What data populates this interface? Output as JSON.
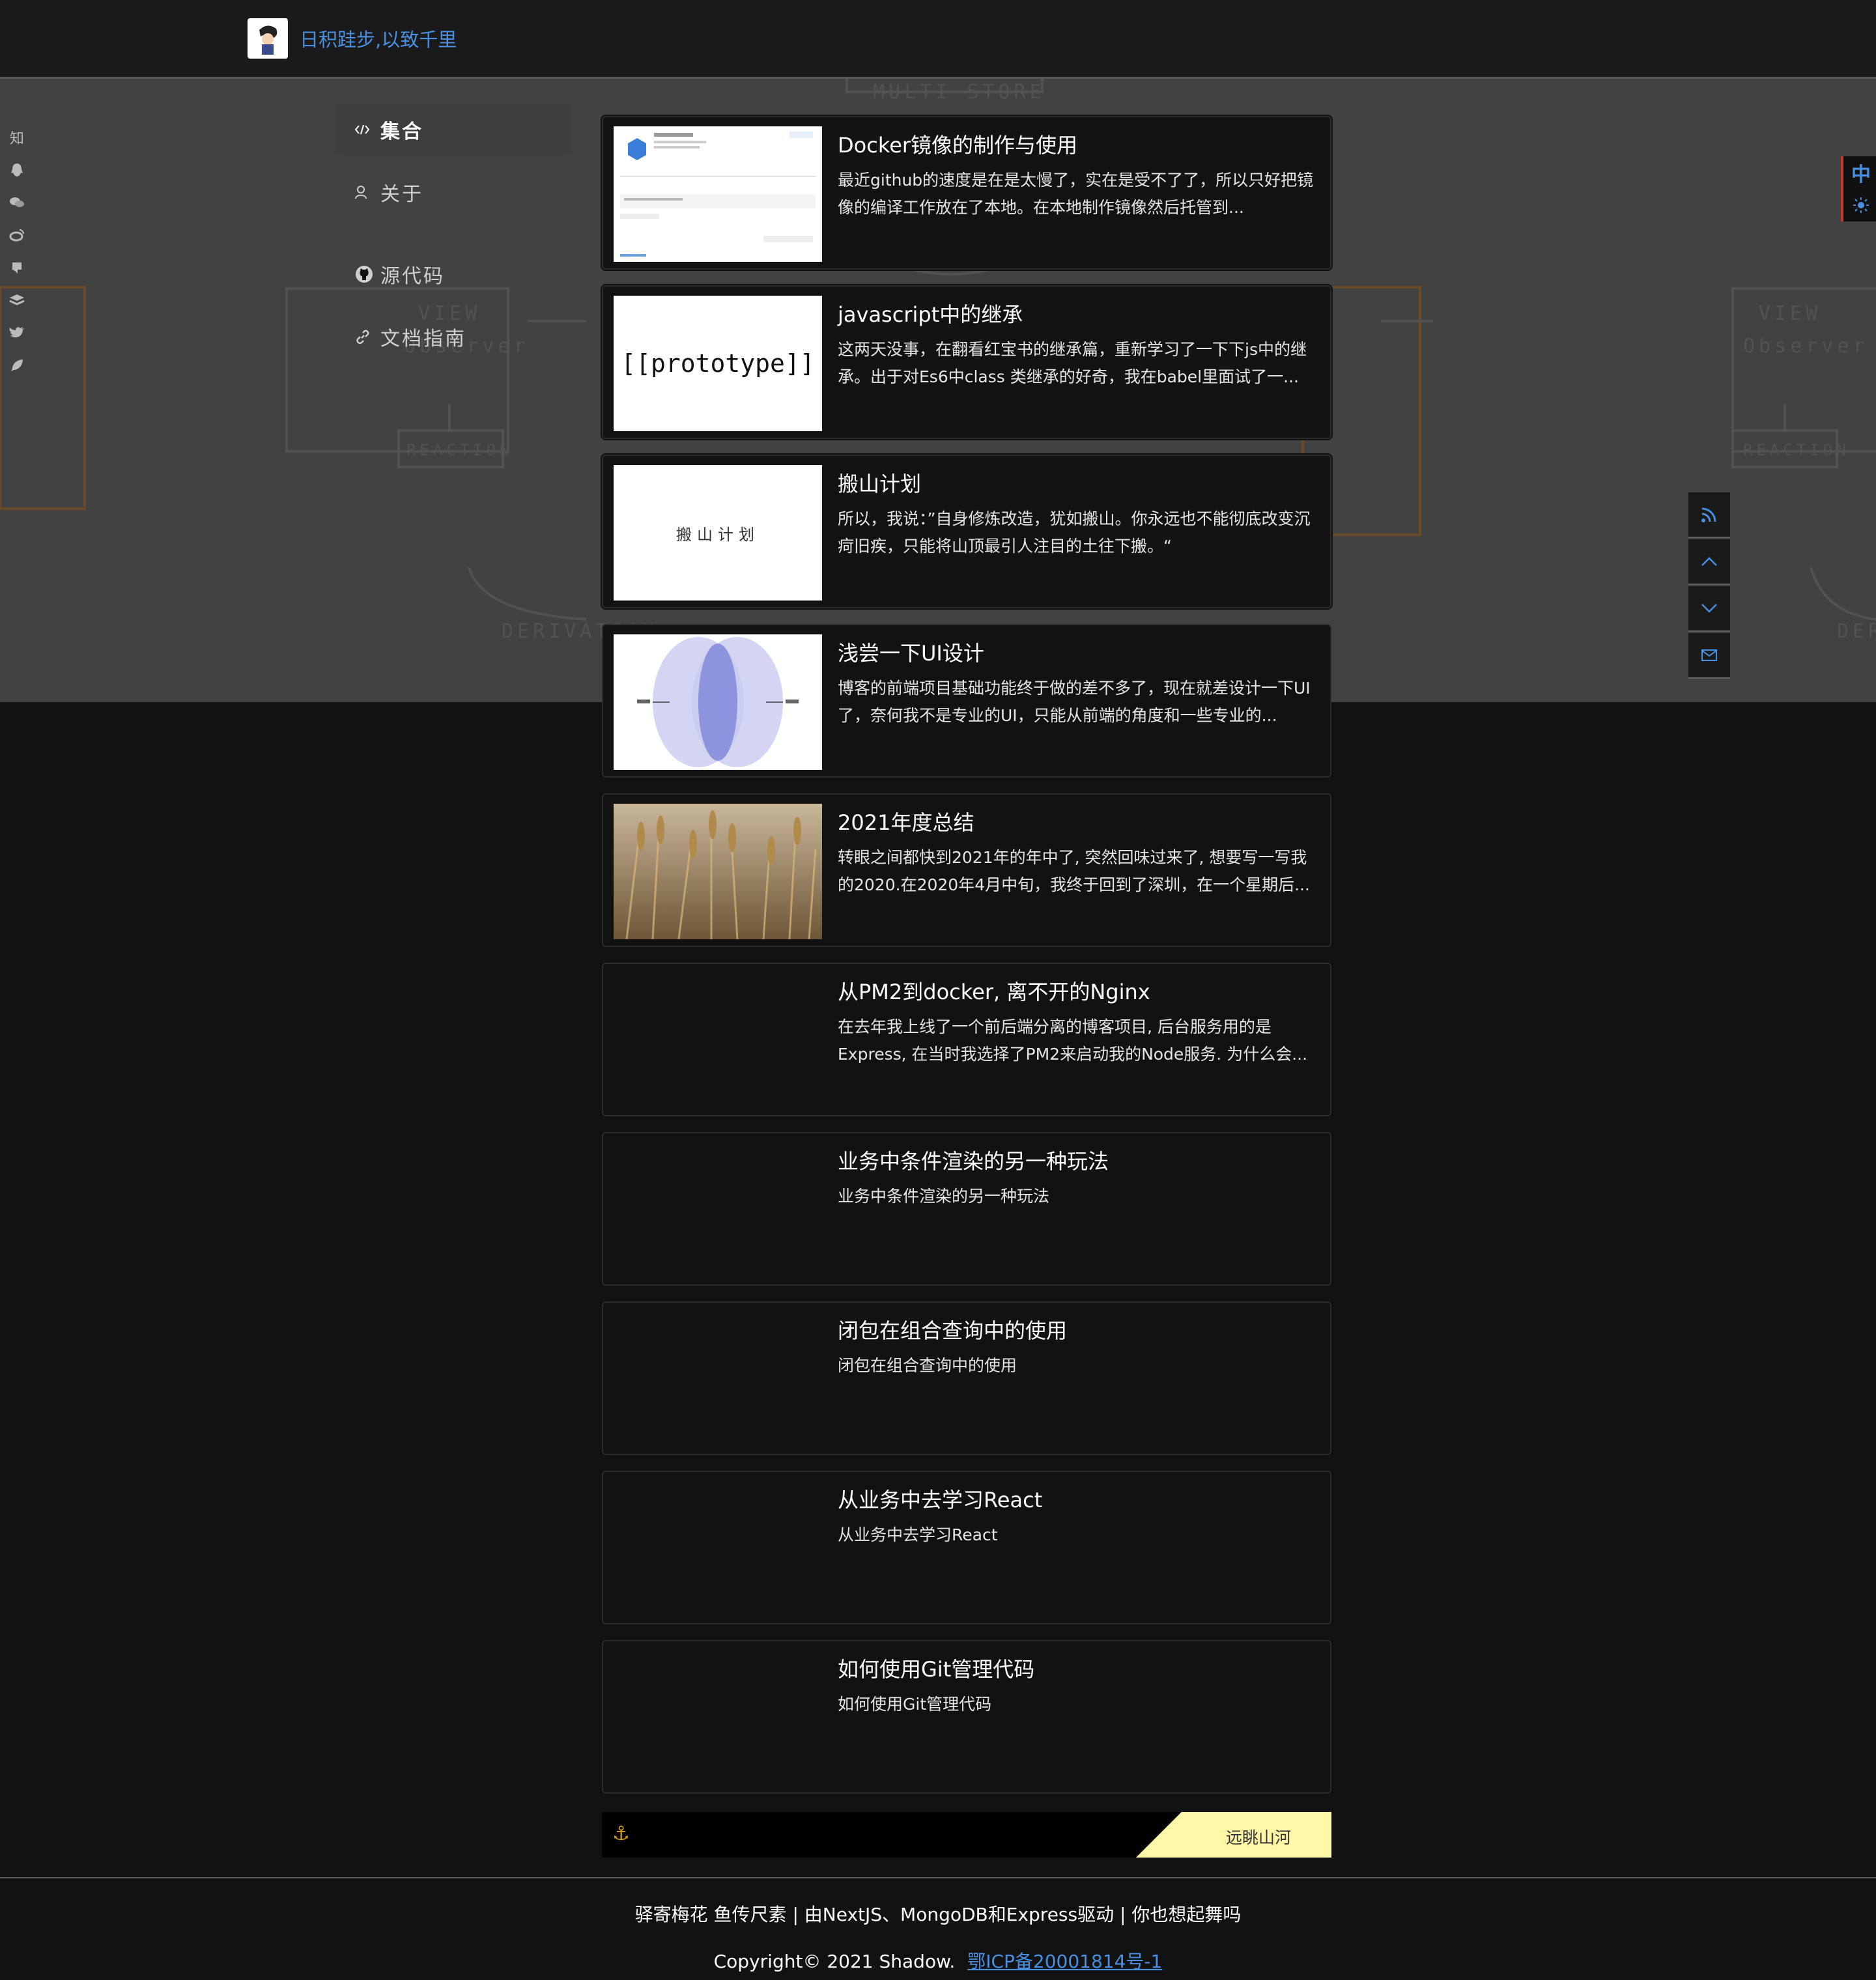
{
  "header": {
    "site_title": "日积跬步,以致千里"
  },
  "hero": {
    "sketch_words": [
      "MULTI STORE",
      "VIEW",
      "Observer",
      "REACTION",
      "DERIVATION"
    ]
  },
  "social": {
    "icons": [
      "zhihu-icon",
      "qq-icon",
      "wechat-icon",
      "weibo-icon",
      "github-icon",
      "stackshare-icon",
      "twitter-icon",
      "feather-icon"
    ],
    "zhihu_label": "知"
  },
  "nav": {
    "collection": "集合",
    "about": "关于",
    "source": "源代码",
    "docs": "文档指南"
  },
  "articles": [
    {
      "title": "Docker镜像的制作与使用",
      "desc": "最近github的速度是在是太慢了，实在是受不了了，所以只好把镜像的编译工作放在了本地。在本地制作镜像然后托管到...",
      "thumb": "docker"
    },
    {
      "title": "javascript中的继承",
      "desc": "这两天没事，在翻看红宝书的继承篇，重新学习了一下下js中的继承。出于对Es6中class 类继承的好奇，我在babel里面试了一...",
      "thumb": "prototype",
      "thumb_text": "[[prototype]]"
    },
    {
      "title": "搬山计划",
      "desc": "所以，我说：”自身修炼改造，犹如搬山。你永远也不能彻底改变沉疴旧疾，只能将山顶最引人注目的土往下搬。“",
      "thumb": "text",
      "thumb_text": "搬山计划"
    },
    {
      "title": "浅尝一下UI设计",
      "desc": "博客的前端项目基础功能终于做的差不多了，现在就差设计一下UI了，奈何我不是专业的UI，只能从前端的角度和一些专业的...",
      "thumb": "venn"
    },
    {
      "title": "2021年度总结",
      "desc": "转眼之间都快到2021年的年中了, 突然回味过来了, 想要写一写我的2020.在2020年4月中旬，我终于回到了深圳，在一个星期后...",
      "thumb": "wheat"
    },
    {
      "title": "从PM2到docker, 离不开的Nginx",
      "desc": "在去年我上线了一个前后端分离的博客项目, 后台服务用的是Express, 在当时我选择了PM2来启动我的Node服务. 为什么会...",
      "thumb": "none"
    },
    {
      "title": "业务中条件渲染的另一种玩法",
      "desc": "业务中条件渲染的另一种玩法",
      "thumb": "none"
    },
    {
      "title": "闭包在组合查询中的使用",
      "desc": "闭包在组合查询中的使用",
      "thumb": "none"
    },
    {
      "title": "从业务中去学习React",
      "desc": "从业务中去学习React",
      "thumb": "none"
    },
    {
      "title": "如何使用Git管理代码",
      "desc": "如何使用Git管理代码",
      "thumb": "none"
    }
  ],
  "banner": {
    "slogan": "远眺山河"
  },
  "footer": {
    "line1": "驿寄梅花 鱼传尺素 | 由NextJS、MongoDB和Express驱动 | 你也想起舞吗",
    "copyright": "Copyright© 2021 Shadow.",
    "icp": "鄂ICP备20001814号-1"
  },
  "float": {
    "lang_label": "中"
  },
  "colors": {
    "accent": "#4a90e2",
    "banner_yellow": "#fff6a8",
    "anchor_gold": "#d4a017"
  }
}
